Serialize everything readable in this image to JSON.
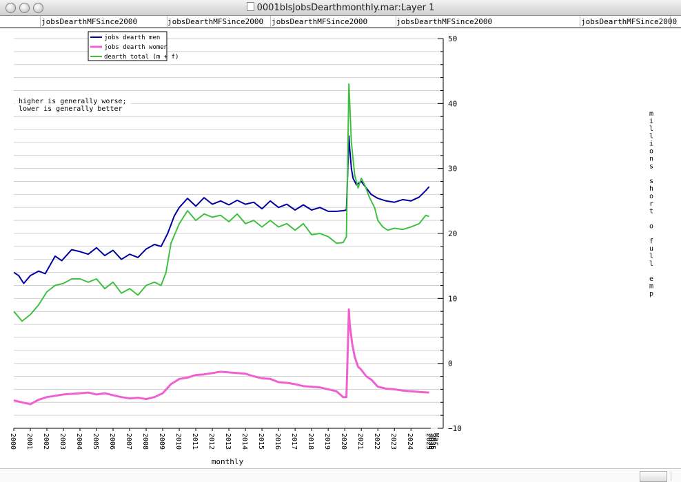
{
  "window": {
    "title": "0001blsJobsDearthmonthly.mar:Layer 1",
    "controls": [
      "close-button",
      "minimize-button",
      "zoom-button"
    ]
  },
  "tabs": [
    {
      "label": "jobsDearthMFSince2000"
    },
    {
      "label": "jobsDearthMFSince2000"
    },
    {
      "label": "jobsDearthMFSince2000"
    },
    {
      "label": "jobsDearthMFSince2000"
    },
    {
      "label": "jobsDearthMFSince2000"
    }
  ],
  "chart_data": {
    "type": "line",
    "xlabel": "monthly",
    "ylabel": "millions short o full emp",
    "ylim": [
      -10,
      50
    ],
    "xlim": [
      2000,
      2025.2
    ],
    "yticks": [
      -10,
      0,
      10,
      20,
      30,
      40,
      50
    ],
    "xticks": [
      "2000",
      "2001",
      "2002",
      "2003",
      "2004",
      "2005",
      "2006",
      "2007",
      "2008",
      "2009",
      "2010",
      "2011",
      "2012",
      "2013",
      "2014",
      "2015",
      "2016",
      "2017",
      "2018",
      "2019",
      "2020",
      "2021",
      "2022",
      "2023",
      "2024"
    ],
    "end_tick_labels": [
      "2025",
      "Mar"
    ],
    "grid": true,
    "legend_position": "top-left",
    "annotation": [
      "higher is generally worse;",
      "lower is generally better"
    ],
    "series": [
      {
        "name": "jobs dearth men",
        "color": "#0000a0",
        "x": [
          2000.0,
          2000.3,
          2000.6,
          2001.0,
          2001.5,
          2001.9,
          2002.5,
          2002.9,
          2003.5,
          2004.0,
          2004.5,
          2005.0,
          2005.5,
          2006.0,
          2006.5,
          2007.0,
          2007.5,
          2008.0,
          2008.5,
          2008.9,
          2009.3,
          2009.7,
          2010.0,
          2010.5,
          2011.0,
          2011.5,
          2012.0,
          2012.5,
          2013.0,
          2013.5,
          2014.0,
          2014.5,
          2015.0,
          2015.5,
          2016.0,
          2016.5,
          2017.0,
          2017.5,
          2018.0,
          2018.5,
          2019.0,
          2019.5,
          2019.9,
          2020.1,
          2020.25,
          2020.3,
          2020.4,
          2020.5,
          2020.7,
          2021.0,
          2021.3,
          2021.6,
          2022.0,
          2022.5,
          2023.0,
          2023.5,
          2024.0,
          2024.5,
          2024.9,
          2025.1
        ],
        "values": [
          14.0,
          13.5,
          12.3,
          13.5,
          14.2,
          13.8,
          16.5,
          15.8,
          17.5,
          17.2,
          16.8,
          17.8,
          16.6,
          17.4,
          16.0,
          16.8,
          16.3,
          17.6,
          18.3,
          18.0,
          20.0,
          22.7,
          24.0,
          25.4,
          24.2,
          25.5,
          24.5,
          25.0,
          24.4,
          25.1,
          24.5,
          24.8,
          23.8,
          25.0,
          24.0,
          24.5,
          23.6,
          24.4,
          23.6,
          24.0,
          23.4,
          23.4,
          23.5,
          23.6,
          35.0,
          33.0,
          30.0,
          28.5,
          27.5,
          28.0,
          27.0,
          26.0,
          25.4,
          25.0,
          24.8,
          25.2,
          25.0,
          25.6,
          26.6,
          27.2
        ]
      },
      {
        "name": "jobs dearth women",
        "color": "#f060d0",
        "x": [
          2000.0,
          2000.5,
          2001.0,
          2001.5,
          2002.0,
          2002.5,
          2003.0,
          2003.5,
          2004.0,
          2004.5,
          2005.0,
          2005.5,
          2006.0,
          2006.5,
          2007.0,
          2007.5,
          2008.0,
          2008.5,
          2009.0,
          2009.5,
          2010.0,
          2010.5,
          2011.0,
          2011.5,
          2012.0,
          2012.5,
          2013.0,
          2013.5,
          2014.0,
          2014.5,
          2015.0,
          2015.5,
          2016.0,
          2016.5,
          2017.0,
          2017.5,
          2018.0,
          2018.5,
          2019.0,
          2019.5,
          2019.9,
          2020.1,
          2020.25,
          2020.3,
          2020.45,
          2020.6,
          2020.8,
          2021.0,
          2021.3,
          2021.6,
          2022.0,
          2022.5,
          2023.0,
          2023.5,
          2024.0,
          2024.5,
          2025.1
        ],
        "values": [
          -5.7,
          -6.0,
          -6.3,
          -5.6,
          -5.2,
          -5.0,
          -4.8,
          -4.7,
          -4.6,
          -4.5,
          -4.8,
          -4.6,
          -4.9,
          -5.2,
          -5.4,
          -5.3,
          -5.5,
          -5.2,
          -4.6,
          -3.2,
          -2.4,
          -2.2,
          -1.8,
          -1.7,
          -1.5,
          -1.3,
          -1.4,
          -1.5,
          -1.6,
          -2.0,
          -2.3,
          -2.4,
          -2.9,
          -3.0,
          -3.2,
          -3.5,
          -3.6,
          -3.7,
          -4.0,
          -4.3,
          -5.2,
          -5.2,
          8.3,
          6.0,
          3.0,
          1.0,
          -0.5,
          -1.0,
          -2.0,
          -2.5,
          -3.6,
          -3.9,
          -4.0,
          -4.2,
          -4.3,
          -4.4,
          -4.5
        ]
      },
      {
        "name": "dearth total (m + f)",
        "color": "#40c040",
        "x": [
          2000.0,
          2000.5,
          2001.0,
          2001.5,
          2002.0,
          2002.5,
          2003.0,
          2003.5,
          2004.0,
          2004.5,
          2005.0,
          2005.5,
          2006.0,
          2006.5,
          2007.0,
          2007.5,
          2008.0,
          2008.5,
          2008.9,
          2009.2,
          2009.5,
          2010.0,
          2010.5,
          2011.0,
          2011.5,
          2012.0,
          2012.5,
          2013.0,
          2013.5,
          2014.0,
          2014.5,
          2015.0,
          2015.5,
          2016.0,
          2016.5,
          2017.0,
          2017.5,
          2018.0,
          2018.5,
          2019.0,
          2019.5,
          2019.9,
          2020.1,
          2020.25,
          2020.3,
          2020.4,
          2020.6,
          2020.8,
          2021.0,
          2021.2,
          2021.5,
          2021.8,
          2022.0,
          2022.3,
          2022.6,
          2023.0,
          2023.5,
          2024.0,
          2024.5,
          2024.9,
          2025.1
        ],
        "values": [
          8.0,
          6.5,
          7.5,
          9.0,
          11.0,
          12.0,
          12.3,
          13.0,
          13.0,
          12.5,
          13.0,
          11.5,
          12.5,
          10.8,
          11.5,
          10.5,
          12.0,
          12.5,
          12.0,
          14.0,
          18.5,
          21.5,
          23.5,
          22.0,
          23.0,
          22.5,
          22.8,
          21.8,
          23.0,
          21.5,
          22.0,
          21.0,
          22.0,
          21.0,
          21.5,
          20.5,
          21.5,
          19.8,
          20.0,
          19.5,
          18.5,
          18.6,
          19.5,
          43.0,
          40.0,
          34.0,
          29.0,
          27.0,
          28.5,
          27.5,
          25.5,
          24.0,
          22.0,
          21.0,
          20.5,
          20.8,
          20.6,
          21.0,
          21.5,
          22.8,
          22.6
        ]
      }
    ]
  }
}
